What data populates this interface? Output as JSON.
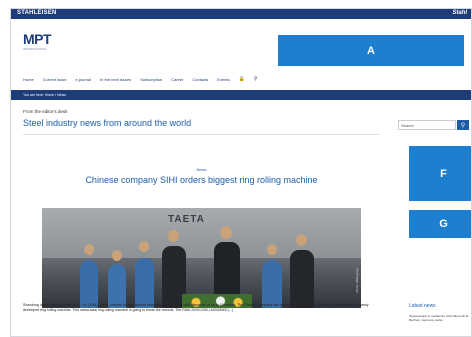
{
  "topbar": {
    "brand": "STAHLEISEN",
    "brand_right": "Stahl"
  },
  "logo": {
    "name": "MPT",
    "tagline": "INTERNATIONAL"
  },
  "ads": {
    "a": "A",
    "f": "F",
    "g": "G"
  },
  "nav": {
    "items": [
      "Home",
      "Current issue",
      "e-journal",
      "In the next issues",
      "Subscription",
      "Career",
      "Contacts",
      "Events"
    ]
  },
  "breadcrumb": "You are here: Home / News",
  "main": {
    "kicker": "From the editor's desk",
    "section_title": "Steel industry news from around the world",
    "news_label": "News",
    "headline": "Chinese company SIHI orders biggest ring rolling machine",
    "photo_sign": "TAETA",
    "photo_credit": "Photo: SMS group",
    "body": "Shandong Iraeta Heavy Industry Co., Ltd. (SIHI), China, intends to manufacture seamlessly rolled rings with diameters of up to 16 metres. The Chinese company has placed an order with SMS group for the supply of a newly developed ring rolling machine. This radial-axial ring rolling machine is going to break the records. The RAW 2000/1250-16000/5000",
    "more": "[...]"
  },
  "sidebar": {
    "search_placeholder": "Search",
    "latest_title": "Latest news",
    "latest_item": "thyssenkrupp to modernize cold rolled mill at Bochum, Germany works"
  },
  "colors": {
    "brand_navy": "#1d3c78",
    "accent_blue": "#1c7fd0",
    "link_blue": "#1d5da8"
  }
}
